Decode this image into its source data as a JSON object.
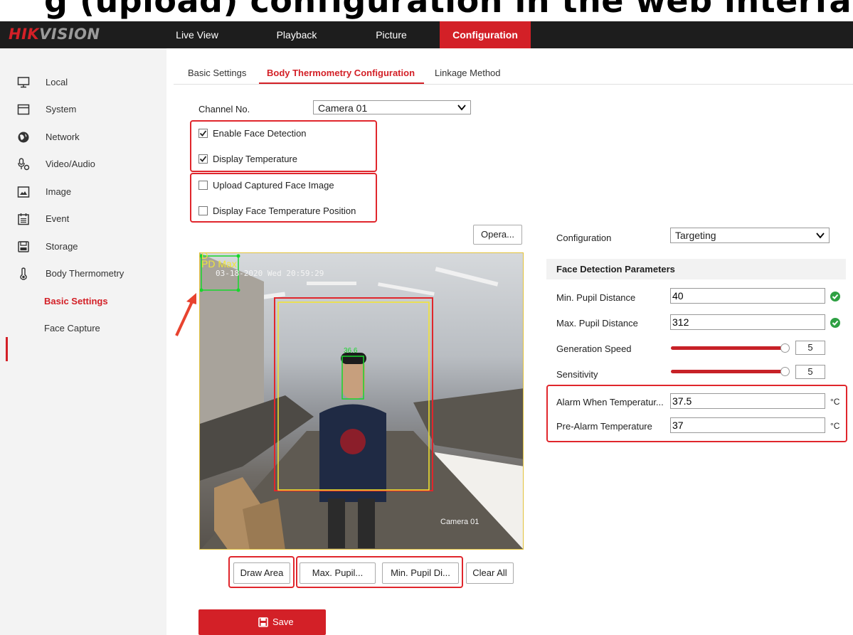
{
  "heading_fragment": "g (upload) configuration in the web interface",
  "nav": {
    "logo_red": "HIK",
    "logo_gray": "VISION",
    "tabs": [
      {
        "label": "Live View"
      },
      {
        "label": "Playback"
      },
      {
        "label": "Picture"
      },
      {
        "label": "Configuration"
      }
    ]
  },
  "sidebar": {
    "items": [
      {
        "label": "Local",
        "icon": "monitor-icon"
      },
      {
        "label": "System",
        "icon": "window-icon"
      },
      {
        "label": "Network",
        "icon": "globe-icon"
      },
      {
        "label": "Video/Audio",
        "icon": "microphone-icon"
      },
      {
        "label": "Image",
        "icon": "image-icon"
      },
      {
        "label": "Event",
        "icon": "calendar-icon"
      },
      {
        "label": "Storage",
        "icon": "disk-icon"
      },
      {
        "label": "Body Thermometry",
        "icon": "thermometer-icon"
      }
    ],
    "sub_items": [
      {
        "label": "Basic Settings"
      },
      {
        "label": "Face Capture"
      }
    ]
  },
  "subtabs": [
    {
      "label": "Basic Settings"
    },
    {
      "label": "Body Thermometry Configuration"
    },
    {
      "label": "Linkage Method"
    }
  ],
  "form": {
    "channel_label": "Channel No.",
    "channel_value": "Camera 01",
    "checkboxes": [
      {
        "label": "Enable Face Detection",
        "checked": true
      },
      {
        "label": "Display Temperature",
        "checked": true
      },
      {
        "label": "Upload Captured Face Image",
        "checked": false
      },
      {
        "label": "Display Face Temperature Position",
        "checked": false
      }
    ],
    "opera_button": "Opera..."
  },
  "video": {
    "osd_timestamp": "03-18-2020 Wed 20:59:29",
    "osd_label_1": "D",
    "osd_label_2": "PD Max",
    "osd_face_temp": "36.6",
    "osd_camera": "Camera 01"
  },
  "video_buttons": [
    {
      "label": "Draw Area"
    },
    {
      "label": "Max. Pupil..."
    },
    {
      "label": "Min. Pupil Di..."
    },
    {
      "label": "Clear All"
    }
  ],
  "config": {
    "configuration_label": "Configuration",
    "configuration_value": "Targeting",
    "section_title": "Face Detection Parameters",
    "min_pupil_label": "Min. Pupil Distance",
    "min_pupil_value": "40",
    "max_pupil_label": "Max. Pupil Distance",
    "max_pupil_value": "312",
    "generation_speed_label": "Generation Speed",
    "generation_speed_value": "5",
    "generation_speed_max": 5,
    "sensitivity_label": "Sensitivity",
    "sensitivity_value": "5",
    "sensitivity_max": 5,
    "alarm_label": "Alarm When Temperatur...",
    "alarm_value": "37.5",
    "pre_alarm_label": "Pre-Alarm Temperature",
    "pre_alarm_value": "37",
    "unit": "°C"
  },
  "save_label": "Save",
  "colors": {
    "accent": "#d32027",
    "nav_bg": "#1d1d1d",
    "highlight_box": "#e0262c",
    "ok_green": "#2ea043"
  }
}
